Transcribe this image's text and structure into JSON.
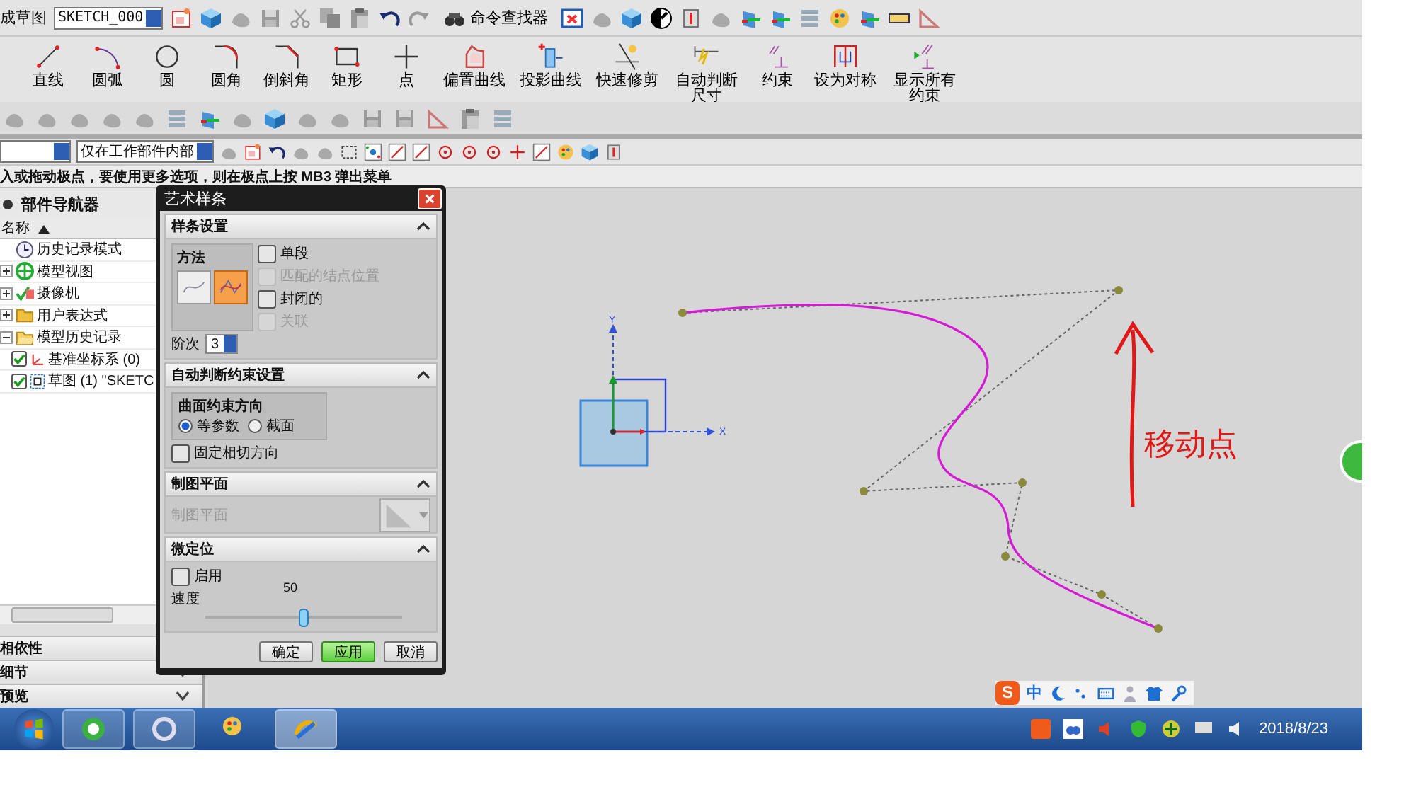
{
  "toolbar": {
    "label": "成草图",
    "sketch": "SKETCH_000",
    "finder": "命令查找器"
  },
  "ribbon": [
    {
      "label": "直线"
    },
    {
      "label": "圆弧"
    },
    {
      "label": "圆"
    },
    {
      "label": "圆角"
    },
    {
      "label": "倒斜角"
    },
    {
      "label": "矩形"
    },
    {
      "label": "点"
    },
    {
      "label": "偏置曲线"
    },
    {
      "label": "投影曲线"
    },
    {
      "label": "快速修剪"
    },
    {
      "label": "自动判断尺寸"
    },
    {
      "label": "约束"
    },
    {
      "label": "设为对称"
    },
    {
      "label": "显示所有约束"
    }
  ],
  "selection_bar": {
    "scope": "仅在工作部件内部"
  },
  "prompt": "入或拖动极点，要使用更多选项，则在极点上按 MB3 弹出菜单",
  "navigator": {
    "title": "部件导航器",
    "column": "名称",
    "items": [
      {
        "label": "历史记录模式"
      },
      {
        "label": "模型视图",
        "expanded": false
      },
      {
        "label": "摄像机",
        "expanded": false
      },
      {
        "label": "用户表达式",
        "expanded": false
      },
      {
        "label": "模型历史记录",
        "expanded": true,
        "children": [
          {
            "label": "基准坐标系 (0)",
            "checked": true
          },
          {
            "label": "草图 (1) \"SKETC",
            "checked": true
          }
        ]
      }
    ],
    "panels": [
      {
        "label": "相依性"
      },
      {
        "label": "细节"
      },
      {
        "label": "预览"
      }
    ]
  },
  "dialog": {
    "title": "艺术样条",
    "spline_settings": {
      "title": "样条设置",
      "method_label": "方法",
      "methods": [
        {
          "selected": false
        },
        {
          "selected": true
        }
      ],
      "options": [
        {
          "label": "单段",
          "checked": false,
          "disabled": false
        },
        {
          "label": "匹配的结点位置",
          "checked": false,
          "disabled": true
        },
        {
          "label": "封闭的",
          "checked": false,
          "disabled": false
        },
        {
          "label": "关联",
          "checked": false,
          "disabled": true
        }
      ],
      "degree_label": "阶次",
      "degree": "3"
    },
    "constraints": {
      "title": "自动判断约束设置",
      "group": "曲面约束方向",
      "directions": [
        {
          "label": "等参数",
          "selected": true
        },
        {
          "label": "截面",
          "selected": false
        }
      ],
      "fix_tangent": {
        "label": "固定相切方向",
        "checked": false
      }
    },
    "drawing_plane": {
      "title": "制图平面",
      "label": "制图平面"
    },
    "micro_position": {
      "title": "微定位",
      "enable": {
        "label": "启用",
        "checked": false
      },
      "speed_label": "速度",
      "speed_value": "50",
      "level": 0.5
    },
    "buttons": [
      {
        "label": "确定",
        "default": false
      },
      {
        "label": "应用",
        "default": true
      },
      {
        "label": "取消",
        "default": false
      }
    ]
  },
  "canvas": {
    "axis_x": "X",
    "axis_y": "Y",
    "annotation": "移动点"
  },
  "ime": {
    "logo": "S",
    "mode": "中"
  },
  "taskbar": {
    "date": "2018/8/23"
  }
}
